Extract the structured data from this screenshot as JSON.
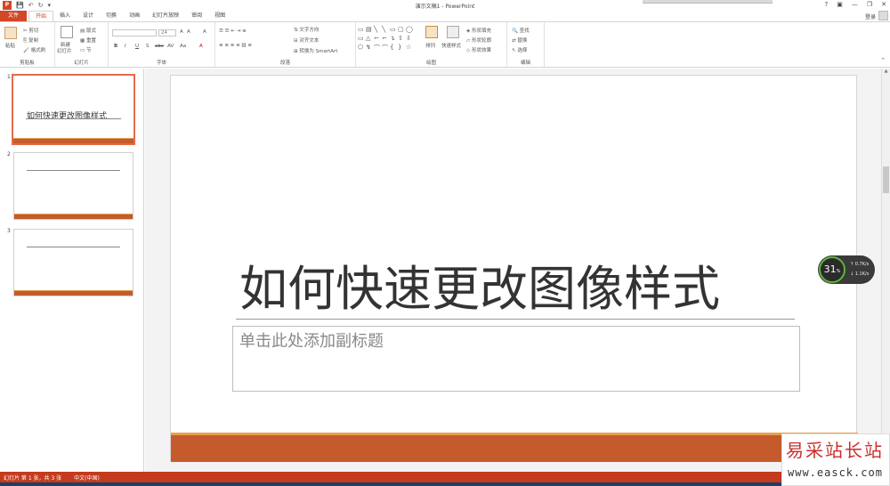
{
  "titlebar": {
    "title": "演示文稿1 - PowerPoint",
    "logo": "P",
    "qat_icons": [
      "save-icon",
      "undo-icon",
      "redo-icon",
      "customize-icon"
    ],
    "controls": [
      "?",
      "▣",
      "—",
      "❐",
      "✕"
    ]
  },
  "tabs": {
    "file": "文件",
    "items": [
      "开始",
      "插入",
      "设计",
      "切换",
      "动画",
      "幻灯片放映",
      "审阅",
      "视图"
    ],
    "active": "开始",
    "login": "登录"
  },
  "ribbon": {
    "clipboard": {
      "label": "剪贴板",
      "paste": "粘贴",
      "cut": "剪切",
      "copy": "复制",
      "format_painter": "格式刷"
    },
    "slides": {
      "label": "幻灯片",
      "new_slide": "新建",
      "new_slide2": "幻灯片",
      "layout": "版式",
      "reset": "重置",
      "section": "节"
    },
    "font": {
      "label": "字体",
      "font_name": "",
      "font_size": "24",
      "bold": "B",
      "italic": "I",
      "underline": "U",
      "shadow": "S",
      "strike": "abc",
      "spacing": "AV",
      "case": "Aa",
      "grow": "A",
      "shrink": "A",
      "clear": "A",
      "color": "A"
    },
    "paragraph": {
      "label": "段落",
      "text_direction": "文字方向",
      "align_text": "对齐文本",
      "smartart": "转换为 SmartArt"
    },
    "drawing": {
      "label": "绘图",
      "arrange": "排列",
      "quick_styles": "快速样式",
      "shape_fill": "形状填充",
      "shape_outline": "形状轮廓",
      "shape_effects": "形状效果"
    },
    "editing": {
      "label": "编辑",
      "find": "查找",
      "replace": "替换",
      "select": "选择"
    }
  },
  "slides_panel": {
    "slides": [
      {
        "num": "1",
        "title": "如何快速更改图像样式"
      },
      {
        "num": "2",
        "title": ""
      },
      {
        "num": "3",
        "title": ""
      }
    ]
  },
  "slide": {
    "title": "如何快速更改图像样式",
    "subtitle_placeholder": "单击此处添加副标题"
  },
  "speed_widget": {
    "percent": "31",
    "percent_unit": "%",
    "upload": "0.7K/s",
    "download": "1.1K/s"
  },
  "statusbar": {
    "slide_info": "幻灯片 第 1 张，共 3 张",
    "language": "中文(中国)"
  },
  "watermark": {
    "top": "易采站长站",
    "bottom": "www.easck.com"
  },
  "colors": {
    "accent": "#d24726",
    "status_bar": "#c43b1d",
    "slide_bar": "#c55a2c"
  }
}
